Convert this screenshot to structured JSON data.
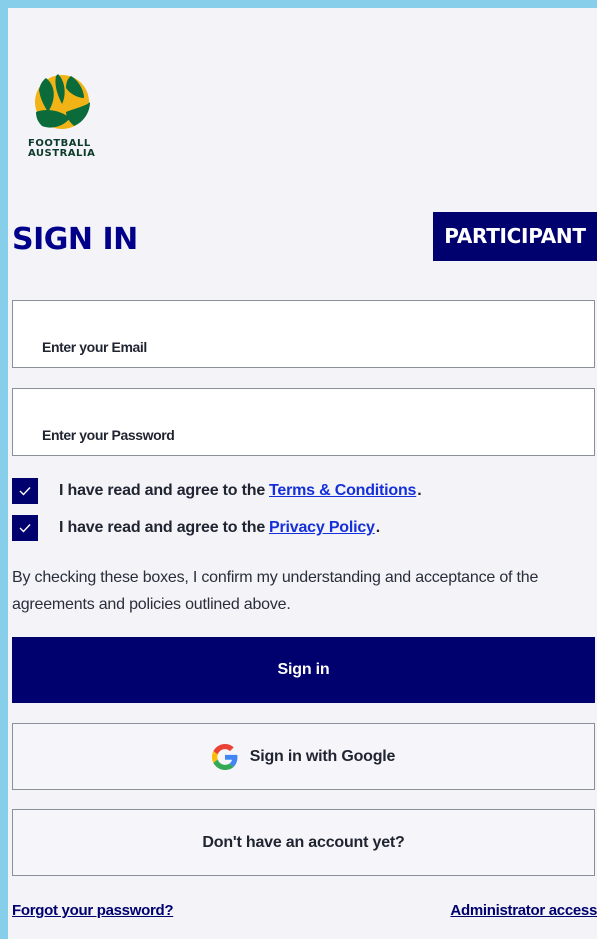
{
  "logo": {
    "line1": "FOOTBALL",
    "line2": "AUSTRALIA",
    "colors": {
      "gold": "#F2B316",
      "green": "#0B6B3A"
    }
  },
  "title": "SIGN IN",
  "badge": "PARTICIPANT",
  "form": {
    "email_placeholder": "Enter your Email",
    "password_placeholder": "Enter your Password"
  },
  "agreements": [
    {
      "text": "I have read and agree to the",
      "link": "Terms & Conditions",
      "suffix": ".",
      "checked": true
    },
    {
      "text": "I have read and agree to the",
      "link": "Privacy Policy",
      "suffix": ".",
      "checked": true
    }
  ],
  "note": "By checking these boxes, I confirm my understanding and acceptance of the agreements and policies outlined above.",
  "buttons": {
    "signin": "Sign in",
    "google": "Sign in with Google",
    "account": "Don't have an account yet?"
  },
  "links": {
    "forgot": "Forgot your password?",
    "admin": "Administrator access"
  },
  "colors": {
    "primary": "#00006E",
    "link": "#1530D8",
    "background": "#F3F3F8",
    "frame": "#87CEEB"
  },
  "icons": {
    "checkbox": "checkmark-icon",
    "google": "google-g-icon",
    "logo": "football-australia-logo"
  }
}
